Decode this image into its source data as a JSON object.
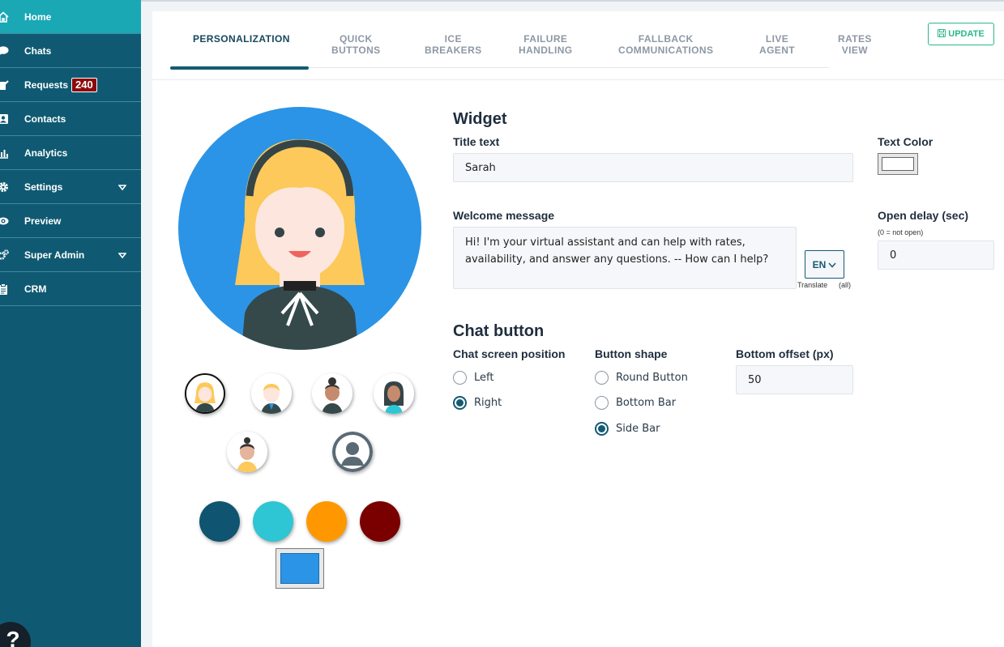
{
  "sidebar": {
    "items": [
      {
        "label": "Home",
        "icon": "home-icon"
      },
      {
        "label": "Chats",
        "icon": "chat-icon"
      },
      {
        "label": "Requests",
        "icon": "requests-icon",
        "badge": "240"
      },
      {
        "label": "Contacts",
        "icon": "contacts-icon"
      },
      {
        "label": "Analytics",
        "icon": "analytics-icon"
      },
      {
        "label": "Settings",
        "icon": "gear-icon"
      },
      {
        "label": "Preview",
        "icon": "eye-icon"
      },
      {
        "label": "Super Admin",
        "icon": "gears-icon"
      },
      {
        "label": "CRM",
        "icon": "clipboard-icon"
      }
    ],
    "help": "?"
  },
  "tabs": [
    {
      "label": "PERSONALIZATION"
    },
    {
      "label": "QUICK\nBUTTONS"
    },
    {
      "label": "ICE\nBREAKERS"
    },
    {
      "label": "FAILURE\nHANDLING"
    },
    {
      "label": "FALLBACK\nCOMMUNICATIONS"
    },
    {
      "label": "LIVE\nAGENT"
    },
    {
      "label": "RATES\nVIEW"
    }
  ],
  "update_label": "UPDATE",
  "widget": {
    "heading": "Widget",
    "title_label": "Title text",
    "title_value": "Sarah",
    "text_color_label": "Text Color",
    "welcome_label": "Welcome message",
    "welcome_value": "Hi! I'm your virtual assistant and can help with rates, availability, and answer any questions. -- How can I help?",
    "lang": "EN",
    "translate": "Translate",
    "translate_all": "(all)",
    "open_delay_label": "Open delay (sec)",
    "open_delay_hint": "(0 = not open)",
    "open_delay_value": "0"
  },
  "chat_button": {
    "heading": "Chat button",
    "position_label": "Chat screen position",
    "position_options": [
      "Left",
      "Right"
    ],
    "shape_label": "Button shape",
    "shape_options": [
      "Round Button",
      "Bottom Bar",
      "Side Bar"
    ],
    "offset_label": "Bottom offset (px)",
    "offset_value": "50"
  },
  "colors": {
    "sidebar": "#0f5a72",
    "sidebar_active": "#1aa8b5",
    "swatches": [
      "#0f5470",
      "#2ec5d4",
      "#ff9800",
      "#7a0000"
    ],
    "custom": "#2b94e6"
  }
}
